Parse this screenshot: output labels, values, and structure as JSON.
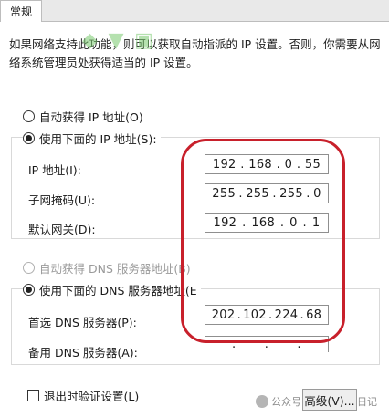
{
  "tab": {
    "label": "常规"
  },
  "description": {
    "line1": "如果网络支持此功能，则可以获取自动指派的 IP 设置。否则，你需要从网",
    "line2": "络系统管理员处获得适当的 IP 设置。"
  },
  "ip_mode": {
    "auto_label": "自动获得 IP 地址(O)",
    "manual_label": "使用下面的 IP 地址(S):",
    "selected": "manual"
  },
  "ip_fields": {
    "ip": {
      "label": "IP 地址(I):",
      "octets": [
        "192",
        "168",
        "0",
        "55"
      ]
    },
    "subnet": {
      "label": "子网掩码(U):",
      "octets": [
        "255",
        "255",
        "255",
        "0"
      ]
    },
    "gateway": {
      "label": "默认网关(D):",
      "octets": [
        "192",
        "168",
        "0",
        "1"
      ]
    }
  },
  "dns_mode": {
    "auto_label": "自动获得 DNS 服务器地址(B)",
    "manual_label": "使用下面的 DNS 服务器地址(E",
    "selected": "manual"
  },
  "dns_fields": {
    "preferred": {
      "label": "首选 DNS 服务器(P):",
      "octets": [
        "202",
        "102",
        "224",
        "68"
      ]
    },
    "alternate": {
      "label": "备用 DNS 服务器(A):",
      "octets": [
        "",
        "",
        "",
        ""
      ]
    }
  },
  "footer": {
    "validate_label": "退出时验证设置(L)",
    "advanced_label": "高级(V)..."
  },
  "watermark": {
    "text": "公众号 ·",
    "name": "日记"
  },
  "colors": {
    "highlight": "#c8202b",
    "panel": "#ffffff",
    "background": "#e9e9e9"
  }
}
